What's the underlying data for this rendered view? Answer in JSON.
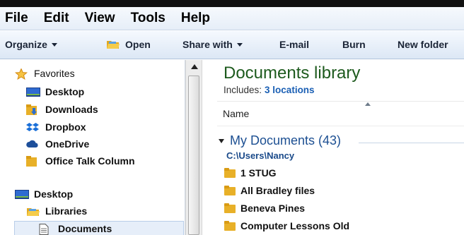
{
  "menubar": {
    "items": [
      "File",
      "Edit",
      "View",
      "Tools",
      "Help"
    ]
  },
  "toolbar": {
    "organize": "Organize",
    "open": "Open",
    "share_with": "Share with",
    "email": "E-mail",
    "burn": "Burn",
    "new_folder": "New folder"
  },
  "nav": {
    "favorites": "Favorites",
    "items": [
      "Desktop",
      "Downloads",
      "Dropbox",
      "OneDrive",
      "Office Talk Column"
    ],
    "desktop": "Desktop",
    "libraries": "Libraries",
    "documents": "Documents"
  },
  "content": {
    "title": "Documents library",
    "includes_label": "Includes:",
    "includes_link": "3 locations",
    "column_name": "Name",
    "group_title": "My Documents (43)",
    "group_path": "C:\\Users\\Nancy",
    "files": [
      "1 STUG",
      "All Bradley files",
      "Beneva Pines",
      "Computer Lessons Old"
    ]
  },
  "colors": {
    "title_green": "#1d5a1d",
    "link_blue": "#1a5fb4",
    "folder_yellow": "#e8b028"
  }
}
